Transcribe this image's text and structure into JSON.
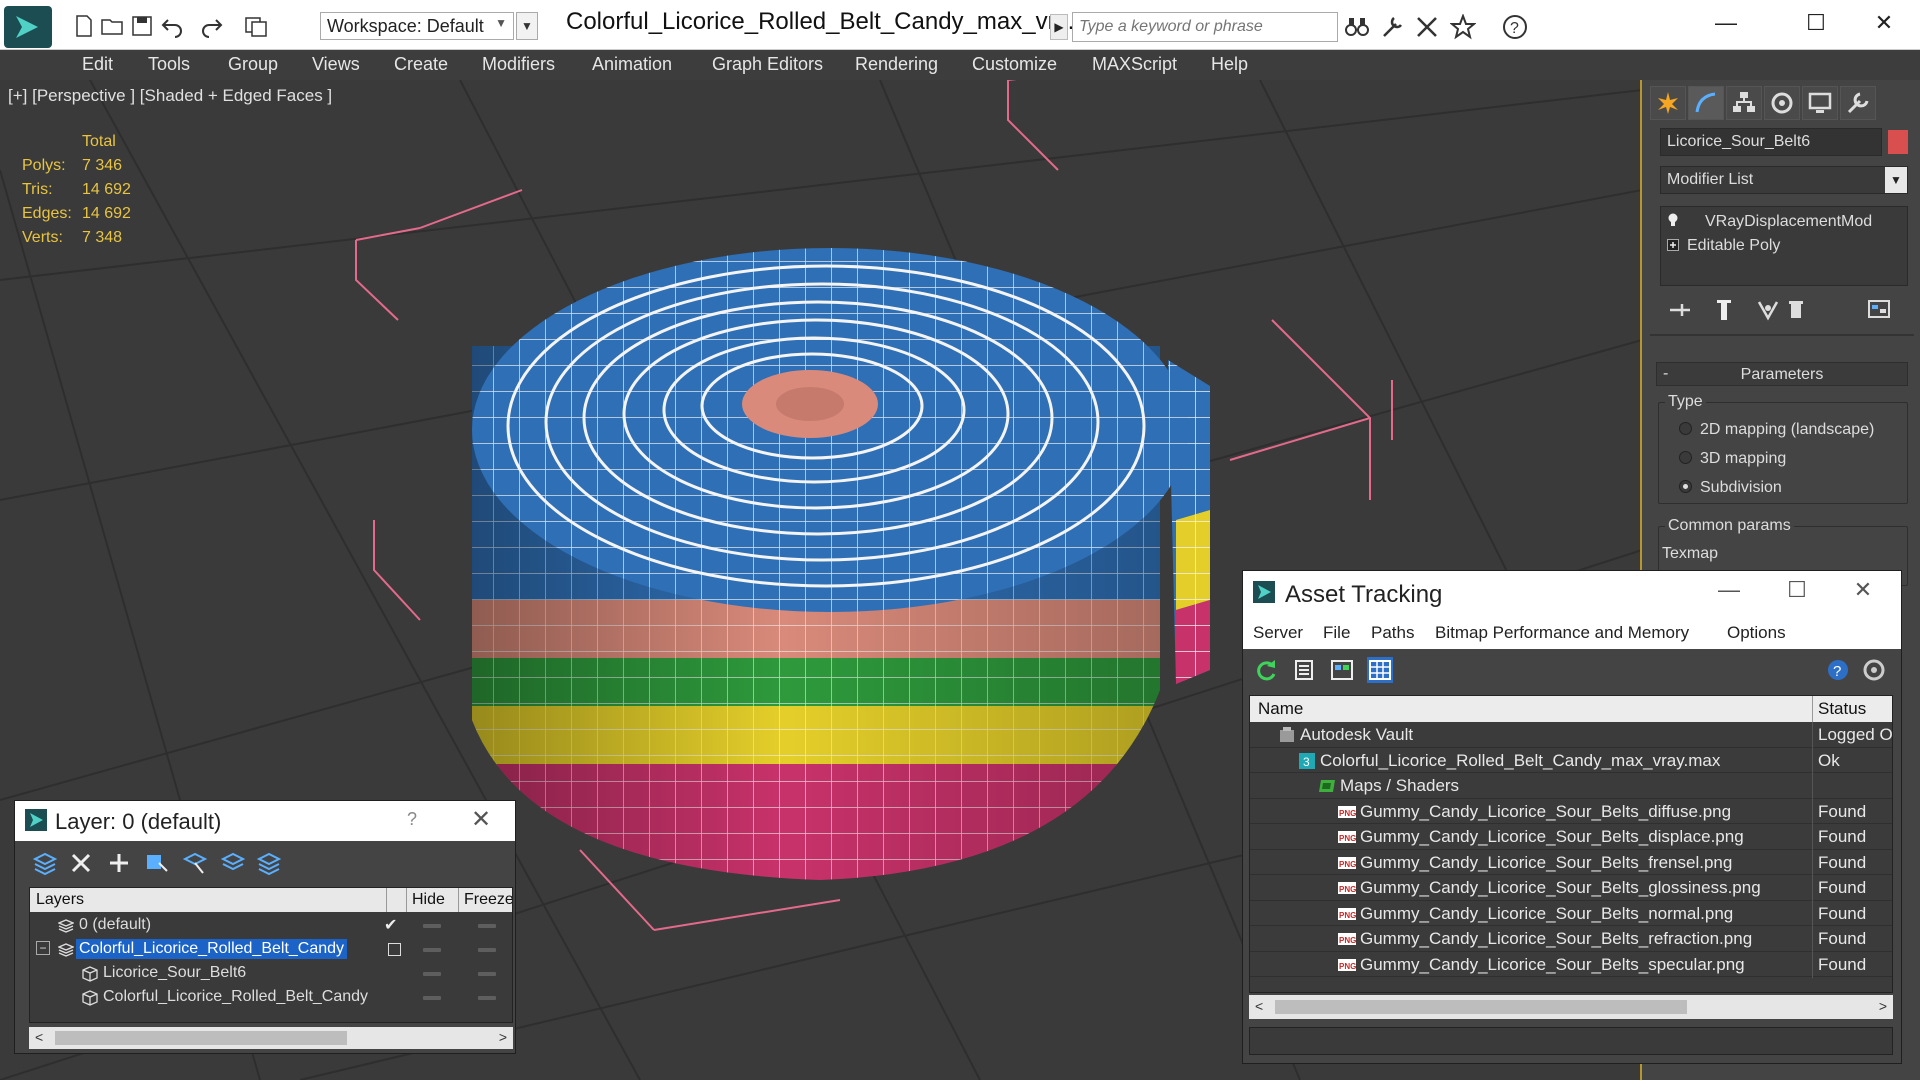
{
  "titlebar": {
    "workspace_label": "Workspace: Default",
    "document_title": "Colorful_Licorice_Rolled_Belt_Candy_max_vr...",
    "search_placeholder": "Type a keyword or phrase",
    "minimize": "—",
    "maximize": "☐",
    "close": "✕"
  },
  "menu": [
    "Edit",
    "Tools",
    "Group",
    "Views",
    "Create",
    "Modifiers",
    "Animation",
    "Graph Editors",
    "Rendering",
    "Customize",
    "MAXScript",
    "Help"
  ],
  "viewport": {
    "label": "[+] [Perspective ] [Shaded + Edged Faces ]",
    "stats": {
      "header": "Total",
      "rows": [
        {
          "key": "Polys:",
          "value": "7 346"
        },
        {
          "key": "Tris:",
          "value": "14 692"
        },
        {
          "key": "Edges:",
          "value": "14 692"
        },
        {
          "key": "Verts:",
          "value": "7 348"
        }
      ]
    }
  },
  "command_panel": {
    "object_name": "Licorice_Sour_Belt6",
    "object_color": "#d94e4e",
    "modifier_list": "Modifier List",
    "stack": [
      "VRayDisplacementMod",
      "Editable Poly"
    ],
    "rollout_title": "Parameters",
    "rollout_toggle": "-",
    "type_group": "Type",
    "type_options": [
      {
        "label": "2D mapping (landscape)",
        "selected": false
      },
      {
        "label": "3D mapping",
        "selected": false
      },
      {
        "label": "Subdivision",
        "selected": true
      }
    ],
    "common_group": "Common params",
    "texmap_label": "Texmap"
  },
  "layer_dialog": {
    "title": "Layer: 0 (default)",
    "help": "?",
    "close": "✕",
    "columns": [
      "Layers",
      "Hide",
      "Freeze"
    ],
    "rows": [
      {
        "name": "0 (default)",
        "indent": 1,
        "selected": false,
        "checked": true
      },
      {
        "name": "Colorful_Licorice_Rolled_Belt_Candy",
        "indent": 1,
        "selected": true,
        "checked": false
      },
      {
        "name": "Licorice_Sour_Belt6",
        "indent": 2,
        "selected": false,
        "checked": false
      },
      {
        "name": "Colorful_Licorice_Rolled_Belt_Candy",
        "indent": 2,
        "selected": false,
        "checked": false
      }
    ]
  },
  "asset_dialog": {
    "title": "Asset Tracking",
    "menu": [
      "Server",
      "File",
      "Paths",
      "Bitmap Performance and Memory",
      "Options"
    ],
    "columns": [
      "Name",
      "Status"
    ],
    "rows": [
      {
        "name": "Autodesk Vault",
        "status": "Logged O",
        "icon": "vault-icon",
        "level": 0
      },
      {
        "name": "Colorful_Licorice_Rolled_Belt_Candy_max_vray.max",
        "status": "Ok",
        "icon": "max-file-icon",
        "level": 1
      },
      {
        "name": "Maps / Shaders",
        "status": "",
        "icon": "maps-icon",
        "level": 2
      },
      {
        "name": "Gummy_Candy_Licorice_Sour_Belts_diffuse.png",
        "status": "Found",
        "icon": "png-icon",
        "level": 3
      },
      {
        "name": "Gummy_Candy_Licorice_Sour_Belts_displace.png",
        "status": "Found",
        "icon": "png-icon",
        "level": 3
      },
      {
        "name": "Gummy_Candy_Licorice_Sour_Belts_frensel.png",
        "status": "Found",
        "icon": "png-icon",
        "level": 3
      },
      {
        "name": "Gummy_Candy_Licorice_Sour_Belts_glossiness.png",
        "status": "Found",
        "icon": "png-icon",
        "level": 3
      },
      {
        "name": "Gummy_Candy_Licorice_Sour_Belts_normal.png",
        "status": "Found",
        "icon": "png-icon",
        "level": 3
      },
      {
        "name": "Gummy_Candy_Licorice_Sour_Belts_refraction.png",
        "status": "Found",
        "icon": "png-icon",
        "level": 3
      },
      {
        "name": "Gummy_Candy_Licorice_Sour_Belts_specular.png",
        "status": "Found",
        "icon": "png-icon",
        "level": 3
      }
    ]
  },
  "colors": {
    "accent_selected": "#1c63c7",
    "stats_text": "#e8c442",
    "viewport_border": "#b8962e",
    "candy_blue": "#2f6fb5",
    "candy_pink": "#d98a7a",
    "candy_green": "#2e9a3c",
    "candy_yellow": "#e4cf2a",
    "candy_magenta": "#c8326a"
  }
}
